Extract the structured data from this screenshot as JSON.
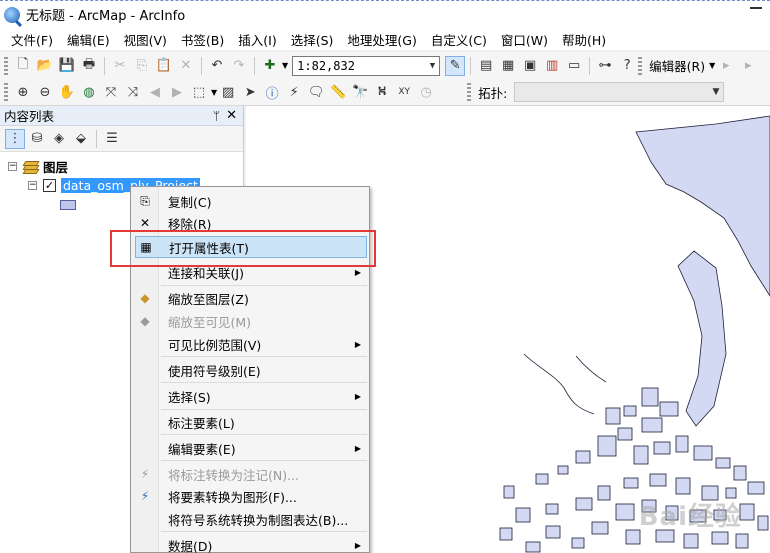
{
  "window": {
    "title": "无标题 - ArcMap - ArcInfo"
  },
  "menubar": {
    "items": [
      "文件(F)",
      "编辑(E)",
      "视图(V)",
      "书签(B)",
      "插入(I)",
      "选择(S)",
      "地理处理(G)",
      "自定义(C)",
      "窗口(W)",
      "帮助(H)"
    ]
  },
  "toolbar": {
    "scale_value": "1:82,832",
    "editor_label": "编辑器(R)",
    "topology_label": "拓扑:"
  },
  "toc": {
    "title": "内容列表",
    "pin_glyph": "ᛘ",
    "close_glyph": "✕",
    "layers_group": "图层",
    "layer_name": "data_osm_ply_Project",
    "layer_fill_color": "#bec6ec"
  },
  "context_menu": {
    "items": [
      {
        "label": "复制(C)",
        "icon": "copy-icon",
        "enabled": true,
        "submenu": false
      },
      {
        "label": "移除(R)",
        "icon": "remove-icon",
        "enabled": true,
        "submenu": false
      },
      {
        "label": "打开属性表(T)",
        "icon": "table-icon",
        "enabled": true,
        "submenu": false,
        "highlighted": true
      },
      {
        "label": "连接和关联(J)",
        "icon": "",
        "enabled": true,
        "submenu": true
      },
      {
        "label": "缩放至图层(Z)",
        "icon": "zoom-layer-icon",
        "enabled": true,
        "submenu": false
      },
      {
        "label": "缩放至可见(M)",
        "icon": "zoom-visible-icon",
        "enabled": false,
        "submenu": false
      },
      {
        "label": "可见比例范围(V)",
        "icon": "",
        "enabled": true,
        "submenu": true
      },
      {
        "label": "使用符号级别(E)",
        "icon": "",
        "enabled": true,
        "submenu": false
      },
      {
        "label": "选择(S)",
        "icon": "",
        "enabled": true,
        "submenu": true
      },
      {
        "label": "标注要素(L)",
        "icon": "",
        "enabled": true,
        "submenu": false
      },
      {
        "label": "编辑要素(E)",
        "icon": "",
        "enabled": true,
        "submenu": true
      },
      {
        "label": "将标注转换为注记(N)...",
        "icon": "convert-labels-icon",
        "enabled": false,
        "submenu": false
      },
      {
        "label": "将要素转换为图形(F)...",
        "icon": "convert-features-icon",
        "enabled": true,
        "submenu": false
      },
      {
        "label": "将符号系统转换为制图表达(B)...",
        "icon": "",
        "enabled": true,
        "submenu": false
      },
      {
        "label": "数据(D)",
        "icon": "",
        "enabled": true,
        "submenu": true
      }
    ]
  },
  "colors": {
    "map_polygon_fill": "#d3d9f3",
    "map_polygon_stroke": "#1f1f3a",
    "highlight_box": "#e53935",
    "selection": "#3399ff"
  },
  "watermark": "Bai经验"
}
